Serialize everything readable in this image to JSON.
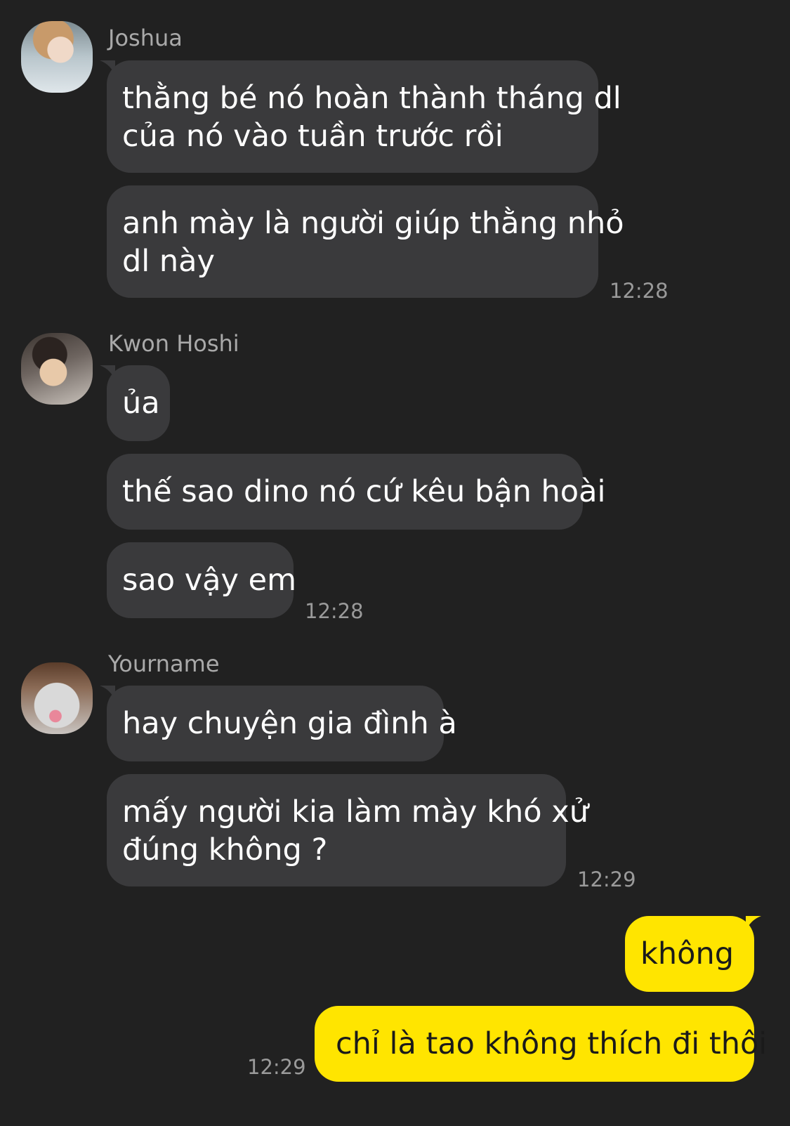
{
  "messages": {
    "group1": {
      "sender": "Joshua",
      "bubbles": [
        "thằng bé nó hoàn thành tháng dl\ncủa nó vào tuần trước rồi",
        "anh mày là người giúp thằng nhỏ\ndl này"
      ],
      "time": "12:28"
    },
    "group2": {
      "sender": "Kwon Hoshi",
      "bubbles": [
        "ủa",
        "thế sao dino nó cứ kêu bận hoài",
        "sao vậy em"
      ],
      "time": "12:28"
    },
    "group3": {
      "sender": "Yourname",
      "bubbles": [
        "hay chuyện gia đình à",
        "mấy người kia làm mày khó xử\nđúng không ?"
      ],
      "time": "12:29"
    },
    "mine": {
      "bubbles": [
        "không",
        "chỉ là tao không thích đi thôi"
      ],
      "time": "12:29"
    }
  },
  "colors": {
    "background": "#212121",
    "incoming_bubble": "#3a3a3c",
    "outgoing_bubble": "#ffe500"
  }
}
